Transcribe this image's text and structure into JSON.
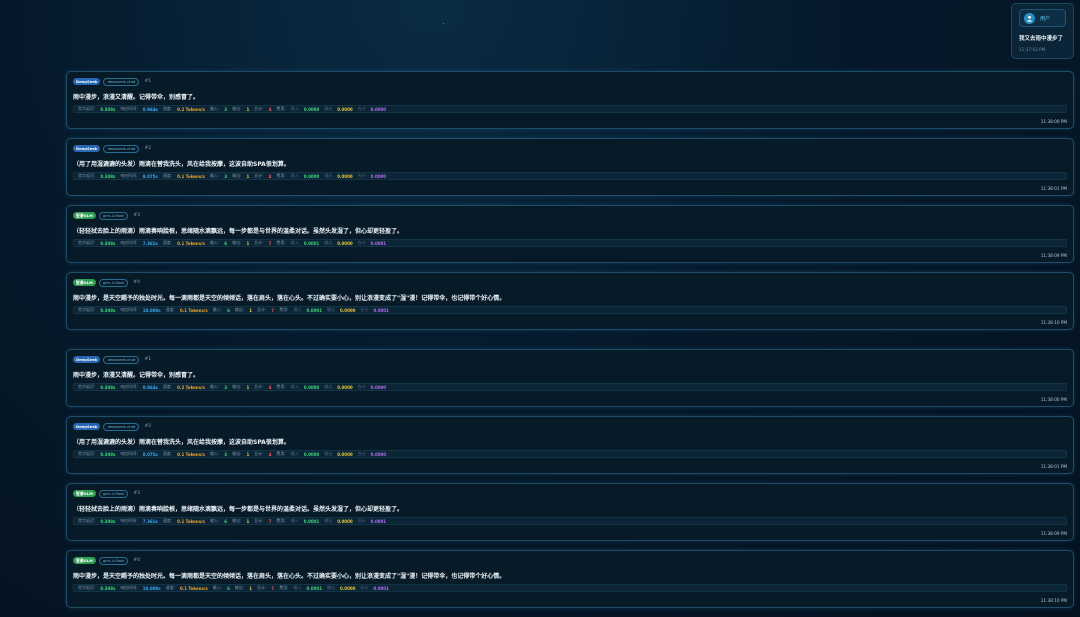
{
  "user": {
    "label": "用户",
    "avatar_icon": "user-icon",
    "message": "我又去雨中漫步了",
    "time": "11:37:03 PM"
  },
  "metric_labels": {
    "ttft": "首字延迟:",
    "resp": "响应时间:",
    "speed": "速度:",
    "input": "输入:",
    "output": "输出:",
    "total": "总计:",
    "cost": "费用:",
    "in": "输入",
    "out": "输出",
    "sum": "合计"
  },
  "messages": [
    {
      "provider": "DeepSeek",
      "kind": "deepseek",
      "model": "deepseek-chat",
      "index": "#1",
      "text": "雨中漫步，浪漫又清醒。记得带伞，别感冒了。",
      "ttft": "0.308s",
      "resp": "0.964s",
      "speed": "0.2 Tokens/s",
      "input": "3",
      "output": "1",
      "total": "4",
      "cost_in": "0.0000",
      "cost_out": "0.0000",
      "cost_sum": "0.0000",
      "time": "11:38:00 PM"
    },
    {
      "provider": "DeepSeek",
      "kind": "deepseek",
      "model": "deepseek-chat",
      "index": "#2",
      "text": "（用了用湿漉漉的头发）雨滴在替我洗头，风在给我按摩，这波自助SPA很划算。",
      "ttft": "0.308s",
      "resp": "8.075s",
      "speed": "0.1 Tokens/s",
      "input": "3",
      "output": "1",
      "total": "4",
      "cost_in": "0.0000",
      "cost_out": "0.0000",
      "cost_sum": "0.0000",
      "time": "11:38:01 PM"
    },
    {
      "provider": "智谱GLM",
      "kind": "zhipu",
      "model": "glm-4-flash",
      "index": "#3",
      "text": "（轻轻拭去脸上的雨滴）雨滴奏响脍根，思绪随水滴飘远，每一步都是与世界的温柔对话。虽然头发湿了，但心却更轻盈了。",
      "ttft": "0.308s",
      "resp": "7.361s",
      "speed": "0.1 Tokens/s",
      "input": "6",
      "output": "1",
      "total": "7",
      "cost_in": "0.0001",
      "cost_out": "0.0000",
      "cost_sum": "0.0001",
      "time": "11:38:09 PM"
    },
    {
      "provider": "智谱GLM",
      "kind": "zhipu",
      "model": "glm-4-flash",
      "index": "#4",
      "text": "雨中漫步，是天空赐予的独处时光。每一滴雨都是天空的倾倾话，落在肩头，落在心头。不过确实要小心，别让浪漫变成了\"湿\"漫！记得带伞，也记得带个好心情。",
      "ttft": "0.308s",
      "resp": "10.008s",
      "speed": "0.1 Tokens/s",
      "input": "6",
      "output": "1",
      "total": "7",
      "cost_in": "0.0001",
      "cost_out": "0.0000",
      "cost_sum": "0.0001",
      "time": "11:38:10 PM"
    },
    {
      "provider": "DeepSeek",
      "kind": "deepseek",
      "model": "deepseek-chat",
      "index": "#1",
      "text": "雨中漫步，浪漫又清醒。记得带伞，别感冒了。",
      "ttft": "0.308s",
      "resp": "0.964s",
      "speed": "0.2 Tokens/s",
      "input": "3",
      "output": "1",
      "total": "4",
      "cost_in": "0.0000",
      "cost_out": "0.0000",
      "cost_sum": "0.0000",
      "time": "11:38:00 PM"
    },
    {
      "provider": "DeepSeek",
      "kind": "deepseek",
      "model": "deepseek-chat",
      "index": "#2",
      "text": "（用了用湿漉漉的头发）雨滴在替我洗头，风在给我按摩，这波自助SPA很划算。",
      "ttft": "0.308s",
      "resp": "8.075s",
      "speed": "0.1 Tokens/s",
      "input": "3",
      "output": "1",
      "total": "4",
      "cost_in": "0.0000",
      "cost_out": "0.0000",
      "cost_sum": "0.0000",
      "time": "11:38:01 PM"
    },
    {
      "provider": "智谱GLM",
      "kind": "zhipu",
      "model": "glm-4-flash",
      "index": "#3",
      "text": "（轻轻拭去脸上的雨滴）雨滴奏响脍根，思绪随水滴飘远，每一步都是与世界的温柔对话。虽然头发湿了，但心却更轻盈了。",
      "ttft": "0.308s",
      "resp": "7.361s",
      "speed": "0.1 Tokens/s",
      "input": "6",
      "output": "1",
      "total": "7",
      "cost_in": "0.0001",
      "cost_out": "0.0000",
      "cost_sum": "0.0001",
      "time": "11:38:09 PM"
    },
    {
      "provider": "智谱GLM",
      "kind": "zhipu",
      "model": "glm-4-flash",
      "index": "#4",
      "text": "雨中漫步，是天空赐予的独处时光。每一滴雨都是天空的倾倾话，落在肩头，落在心头。不过确实要小心，别让浪漫变成了\"湿\"漫！记得带伞，也记得带个好心情。",
      "ttft": "0.308s",
      "resp": "10.008s",
      "speed": "0.1 Tokens/s",
      "input": "6",
      "output": "1",
      "total": "7",
      "cost_in": "0.0001",
      "cost_out": "0.0000",
      "cost_sum": "0.0001",
      "time": "11:38:10 PM"
    }
  ]
}
